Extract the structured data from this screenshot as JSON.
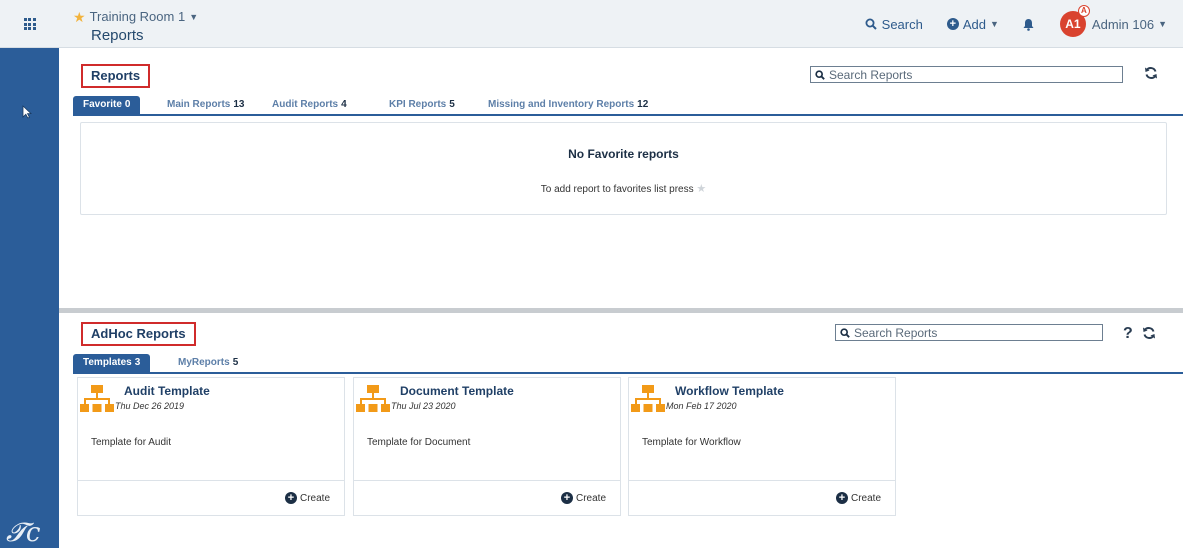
{
  "header": {
    "room_name": "Training Room 1",
    "page_title": "Reports",
    "search_label": "Search",
    "add_label": "Add",
    "avatar_initials": "A1",
    "avatar_badge": "A",
    "user_name": "Admin 106"
  },
  "reports": {
    "title": "Reports",
    "search_placeholder": "Search Reports",
    "tabs": [
      {
        "label": "Favorite",
        "count": "0"
      },
      {
        "label": "Main Reports",
        "count": "13"
      },
      {
        "label": "Audit Reports",
        "count": "4"
      },
      {
        "label": "KPI Reports",
        "count": "5"
      },
      {
        "label": "Missing and Inventory Reports",
        "count": "12"
      }
    ],
    "empty_title": "No Favorite reports",
    "empty_note": "To add report to favorites list press"
  },
  "adhoc": {
    "title": "AdHoc Reports",
    "search_placeholder": "Search Reports",
    "help": "?",
    "tabs": [
      {
        "label": "Templates",
        "count": "3"
      },
      {
        "label": "MyReports",
        "count": "5"
      }
    ],
    "templates": [
      {
        "title": "Audit Template",
        "date": "Thu Dec 26 2019",
        "description": "Template for Audit",
        "action": "Create"
      },
      {
        "title": "Document Template",
        "date": "Thu Jul 23 2020",
        "description": "Template for Document",
        "action": "Create"
      },
      {
        "title": "Workflow Template",
        "date": "Mon Feb 17 2020",
        "description": "Template for Workflow",
        "action": "Create"
      }
    ]
  },
  "icons": {
    "apps": "apps-grid-icon",
    "favorite": "star-icon",
    "search": "magnifier-icon",
    "add": "plus-circle-icon",
    "notifications": "bell-icon",
    "refresh": "refresh-icon",
    "template": "org-chart-icon",
    "sidebar_logo": "brand-logo"
  },
  "colors": {
    "accent": "#2b5d99",
    "highlight_box": "#d02b2b",
    "template_icon": "#f29a18",
    "favorite_star": "#f2b33d"
  }
}
